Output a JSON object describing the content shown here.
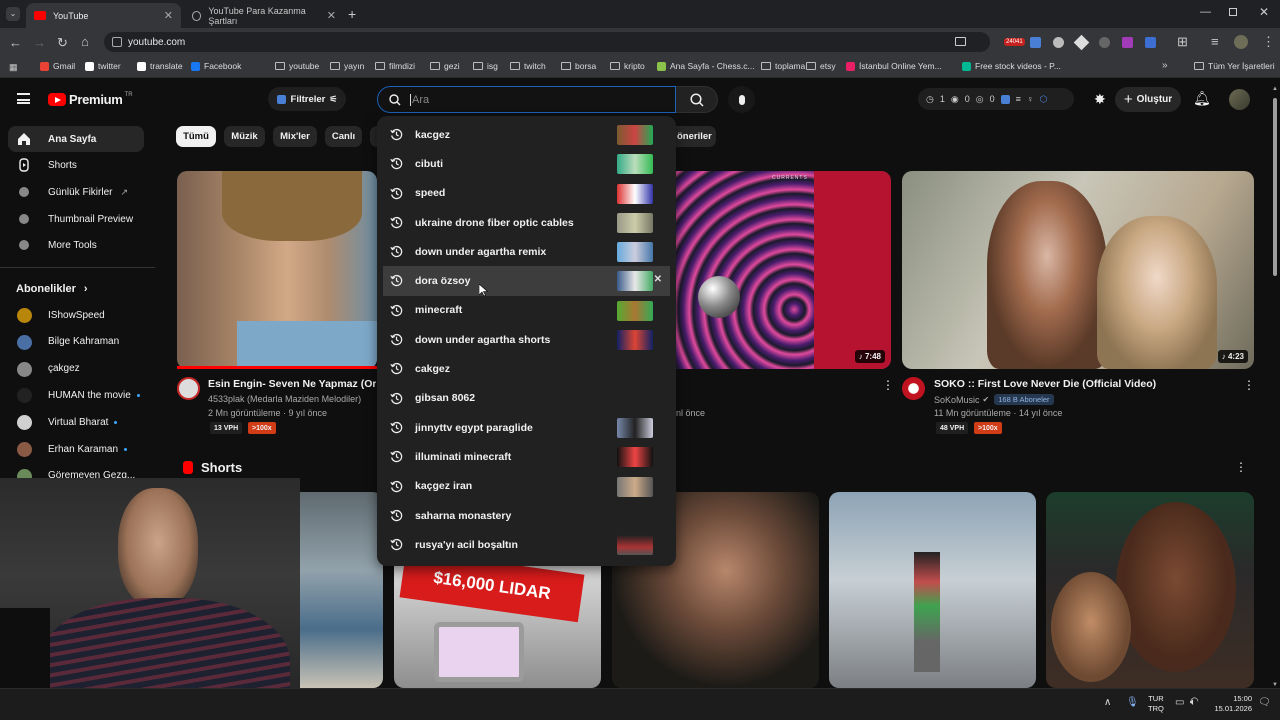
{
  "browser": {
    "tabs": [
      {
        "title": "YouTube",
        "active": true
      },
      {
        "title": "YouTube Para Kazanma Şartları",
        "active": false
      }
    ],
    "url": "youtube.com",
    "ext_badge": "24041",
    "bookmarks": [
      "Gmail",
      "twitter",
      "translate",
      "Facebook",
      "youtube",
      "yayın",
      "filmdizi",
      "gezi",
      "isg",
      "twitch",
      "borsa",
      "kripto",
      "Ana Sayfa - Chess.c...",
      "toplama",
      "etsy",
      "İstanbul Online Yem...",
      "Free stock videos - P..."
    ],
    "all_bookmarks": "Tüm Yer İşaretleri"
  },
  "header": {
    "logo": "Premium",
    "country": "TR",
    "filters": "Filtreler",
    "search_placeholder": "Ara",
    "stats": [
      "1",
      "0",
      "0"
    ],
    "create": "Oluştur"
  },
  "sidebar": {
    "items": [
      "Ana Sayfa",
      "Shorts",
      "Günlük Fikirler",
      "Thumbnail Preview",
      "More Tools"
    ],
    "subscriptions_title": "Abonelikler",
    "subscriptions": [
      "IShowSpeed",
      "Bilge Kahraman",
      "çakgez",
      "HUMAN the movie",
      "Virtual Bharat",
      "Erhan Karaman",
      "Göremeyen Gezg..."
    ]
  },
  "chips": [
    "Tümü",
    "Müzik",
    "Mix'ler",
    "Canlı",
    "öneriler"
  ],
  "suggestions": [
    "kacgez",
    "cibuti",
    "speed",
    "ukraine drone fiber optic cables",
    "down under agartha remix",
    "dora özsoy",
    "minecraft",
    "down under agartha shorts",
    "cakgez",
    "gibsan 8062",
    "jinnyttv egypt paraglide",
    "illuminati minecraft",
    "kaçgez iran",
    "saharna monastery",
    "rusya'yı acil boşaltın"
  ],
  "videos": [
    {
      "title": "Esin Engin- Seven Ne Yapmaz (Orijin",
      "channel": "4533plak (Medarla Maziden Melodiler)",
      "meta": "2 Mn görüntüleme · 9 yıl önce",
      "vph": "13 VPH",
      "ratio": ">100x"
    },
    {
      "duration": "7:48",
      "meta": "nl önce"
    },
    {
      "title": "SOKO :: First Love Never Die (Official Video)",
      "channel": "SoKoMusic",
      "subs": "168 B Aboneler",
      "meta": "11 Mn görüntüleme · 14 yıl önce",
      "vph": "48 VPH",
      "ratio": ">100x",
      "duration": "4:23"
    }
  ],
  "shorts": {
    "title": "Shorts",
    "lidar_text": "$16,000 LIDAR"
  },
  "album_label": "CURRENTS",
  "taskbar": {
    "lang1": "TUR",
    "lang2": "TRQ",
    "time": "15:00",
    "date": "15.01.2026"
  }
}
